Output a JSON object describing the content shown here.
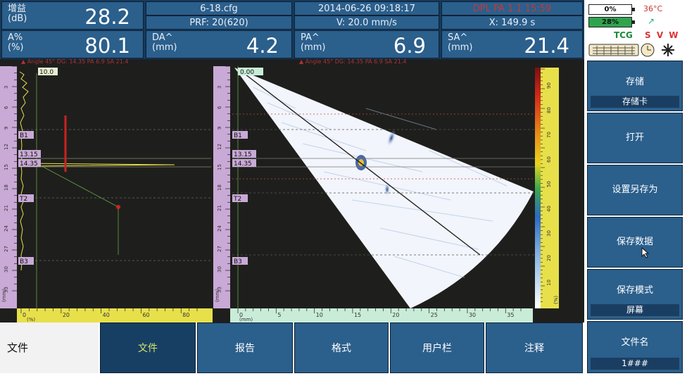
{
  "params": {
    "gain": {
      "label": "增益\n(dB)",
      "value": "28.2"
    },
    "a_pct": {
      "label": "A%\n(%)",
      "value": "80.1"
    },
    "da": {
      "label": "DA^\n(mm)",
      "value": "4.2"
    },
    "pa": {
      "label": "PA^\n(mm)",
      "value": "6.9"
    },
    "sa": {
      "label": "SA^\n(mm)",
      "value": "21.4"
    }
  },
  "info": {
    "file": "6-18.cfg",
    "prf": "PRF: 20(620)",
    "datetime": "2014-06-26 09:18:17",
    "velocity": "V: 20.0 mm/s",
    "mode_red": "DPL PA 1.1 15:59",
    "x_pos": "X: 149.9  s"
  },
  "status": {
    "battery1": "0%",
    "battery2": "28%",
    "temp": "36°C",
    "tcg": "TCG",
    "svw": "S V W"
  },
  "red_strip": {
    "left": "▲ Angle 45°  DG: 14.35  PA 6.9  SA 21.4",
    "right": "▲ Angle 45°  DG: 14.35  PA 6.9  SA 21.4"
  },
  "ascan": {
    "gate_value": "10.0",
    "left_ticks": [
      "3",
      "6",
      "9",
      "12",
      "15",
      "18",
      "21",
      "24",
      "27",
      "30",
      "33"
    ],
    "unit": "(mm)",
    "markers": {
      "b1": "B1",
      "m1": "13.15",
      "m2": "14.35",
      "t2": "T2",
      "b3": "B3"
    },
    "x_ticks": [
      "0",
      "20",
      "40",
      "60",
      "80"
    ],
    "x_unit": "(%)"
  },
  "sscan": {
    "top_value": "0.00",
    "left_ticks": [
      "3",
      "6",
      "9",
      "12",
      "15",
      "18",
      "21",
      "24",
      "27",
      "30",
      "33"
    ],
    "unit": "(mm)",
    "markers": {
      "b1": "B1",
      "m1": "13.15",
      "m2": "14.35",
      "t2": "T2",
      "b3": "B3"
    },
    "x_ticks": [
      "0",
      "5",
      "10",
      "15",
      "20",
      "25",
      "30",
      "35"
    ],
    "x_unit": "(mm)"
  },
  "colorbar": {
    "ticks": [
      "90",
      "80",
      "70",
      "60",
      "50",
      "40",
      "30",
      "20",
      "10"
    ],
    "unit": "(%)"
  },
  "softkeys": [
    {
      "label": "存储",
      "sub": "存储卡"
    },
    {
      "label": "打开",
      "sub": ""
    },
    {
      "label": "设置另存为",
      "sub": ""
    },
    {
      "label": "保存数据",
      "sub": ""
    },
    {
      "label": "保存模式",
      "sub": "屏幕"
    },
    {
      "label": "文件名",
      "sub": "1###"
    }
  ],
  "tabs": {
    "title": "文件",
    "items": [
      "文件",
      "报告",
      "格式",
      "用户栏",
      "注释"
    ]
  },
  "colors": {
    "panel": "#2b5f8c",
    "active_tab_text": "#d6e86a",
    "ruler": "#c9a9d6",
    "gate": "#e0d04a",
    "beam_bg": "#1e1f1c"
  }
}
